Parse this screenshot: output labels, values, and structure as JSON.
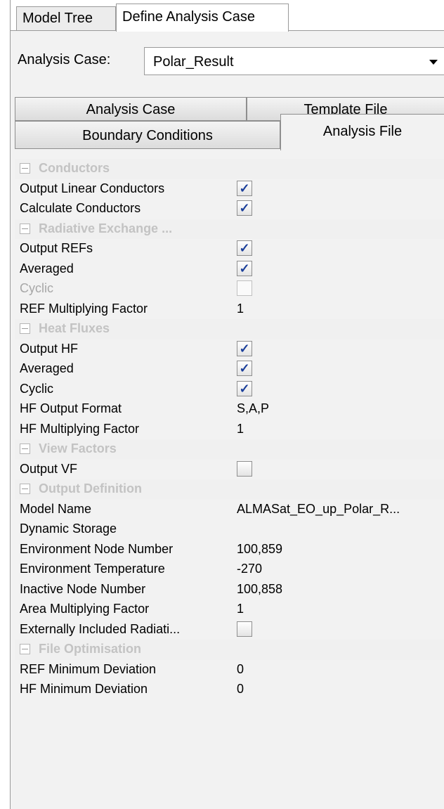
{
  "tabs": {
    "model_tree": "Model Tree",
    "define_analysis_case": "Define Analysis Case"
  },
  "analysis_case": {
    "label": "Analysis Case:",
    "value": "Polar_Result"
  },
  "subtabs": {
    "analysis_case": "Analysis Case",
    "template_file": "Template File",
    "boundary_conditions": "Boundary Conditions",
    "analysis_file": "Analysis File"
  },
  "rows": [
    {
      "kind": "category",
      "label": "Conductors"
    },
    {
      "kind": "check",
      "label": "Output Linear Conductors",
      "checked": true
    },
    {
      "kind": "check",
      "label": "Calculate Conductors",
      "checked": true
    },
    {
      "kind": "category",
      "label": "Radiative Exchange ..."
    },
    {
      "kind": "check",
      "label": "Output REFs",
      "checked": true
    },
    {
      "kind": "check",
      "label": "Averaged",
      "checked": true
    },
    {
      "kind": "check",
      "label": "Cyclic",
      "checked": false,
      "disabled": true
    },
    {
      "kind": "value",
      "label": "REF Multiplying Factor",
      "value": "1"
    },
    {
      "kind": "category",
      "label": "Heat Fluxes"
    },
    {
      "kind": "check",
      "label": "Output HF",
      "checked": true
    },
    {
      "kind": "check",
      "label": "Averaged",
      "checked": true
    },
    {
      "kind": "check",
      "label": "Cyclic",
      "checked": true
    },
    {
      "kind": "value",
      "label": "HF Output Format",
      "value": "S,A,P"
    },
    {
      "kind": "value",
      "label": "HF Multiplying Factor",
      "value": "1"
    },
    {
      "kind": "category",
      "label": "View Factors"
    },
    {
      "kind": "check",
      "label": "Output VF",
      "checked": false
    },
    {
      "kind": "category",
      "label": "Output Definition"
    },
    {
      "kind": "value",
      "label": "Model Name",
      "value": "ALMASat_EO_up_Polar_R..."
    },
    {
      "kind": "value",
      "label": "Dynamic Storage",
      "value": ""
    },
    {
      "kind": "value",
      "label": "Environment Node Number",
      "value": "100,859"
    },
    {
      "kind": "value",
      "label": "Environment Temperature",
      "value": "-270"
    },
    {
      "kind": "value",
      "label": "Inactive Node Number",
      "value": "100,858"
    },
    {
      "kind": "value",
      "label": "Area Multiplying Factor",
      "value": "1"
    },
    {
      "kind": "check",
      "label": "Externally Included Radiati...",
      "checked": false
    },
    {
      "kind": "category",
      "label": "File Optimisation"
    },
    {
      "kind": "value",
      "label": "REF Minimum Deviation",
      "value": "0"
    },
    {
      "kind": "value",
      "label": "HF Minimum Deviation",
      "value": "0"
    }
  ],
  "icons": {
    "checkmark": "✓",
    "dropdown": "chevron-down-icon",
    "collapse": "minus-box-icon"
  }
}
